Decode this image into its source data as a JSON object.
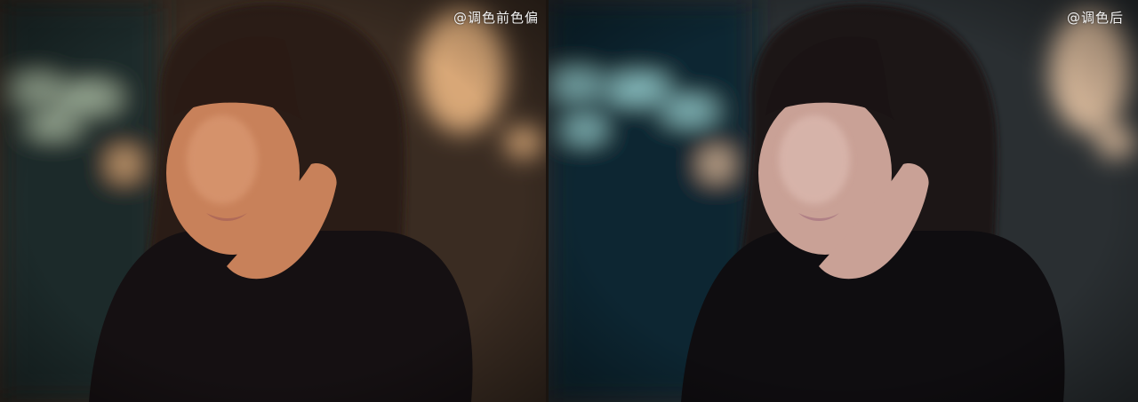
{
  "before": {
    "caption": "@调色前色偏",
    "palette": {
      "background": "#3a2c22",
      "window": "#1f2a2c",
      "bokeh_light": "#9fb09a",
      "bokeh_warm": "#d8a777",
      "hair": "#2a1a14",
      "skin": "#c8815a",
      "skin_highlight": "#e0a07a",
      "sweater": "#151012",
      "lips": "#b06a58"
    }
  },
  "after": {
    "caption": "@调色后",
    "palette": {
      "background": "#2a2f32",
      "window": "#0f2530",
      "bokeh_light": "#8fc7c9",
      "bokeh_warm": "#d6b79a",
      "hair": "#1a1314",
      "skin": "#c9a196",
      "skin_highlight": "#e2c2b9",
      "sweater": "#0f0d10",
      "lips": "#b08086"
    }
  }
}
